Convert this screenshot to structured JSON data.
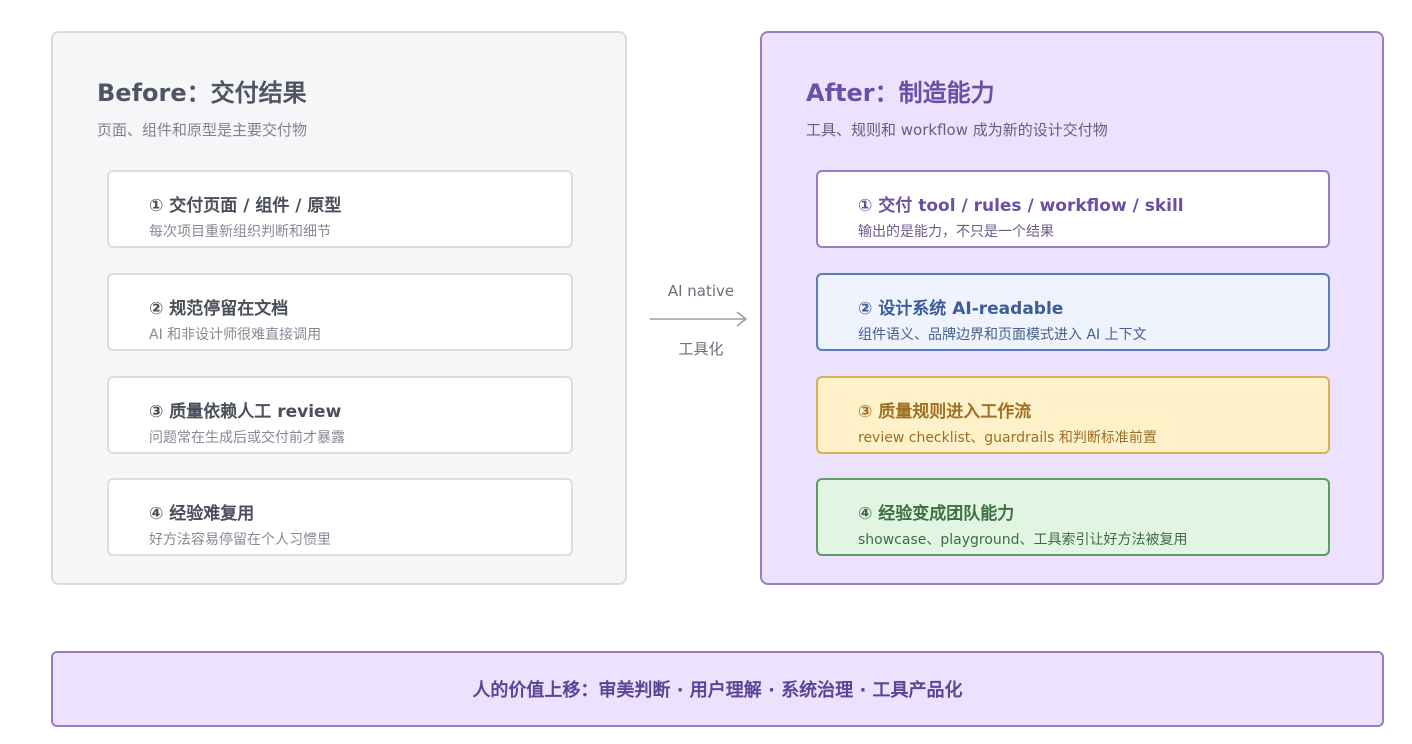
{
  "before": {
    "title": "Before：交付结果",
    "subtitle": "页面、组件和原型是主要交付物",
    "cards": [
      {
        "title": "① 交付页面 / 组件 / 原型",
        "desc": "每次项目重新组织判断和细节"
      },
      {
        "title": "② 规范停留在文档",
        "desc": "AI 和非设计师很难直接调用"
      },
      {
        "title": "③ 质量依赖人工 review",
        "desc": "问题常在生成后或交付前才暴露"
      },
      {
        "title": "④ 经验难复用",
        "desc": "好方法容易停留在个人习惯里"
      }
    ]
  },
  "arrow": {
    "top_label": "AI native",
    "bottom_label": "工具化"
  },
  "after": {
    "title": "After：制造能力",
    "subtitle": "工具、规则和 workflow 成为新的设计交付物",
    "cards": [
      {
        "title": "① 交付 tool / rules / workflow / skill",
        "desc": "输出的是能力，不只是一个结果"
      },
      {
        "title": "② 设计系统 AI-readable",
        "desc": "组件语义、品牌边界和页面模式进入 AI 上下文"
      },
      {
        "title": "③ 质量规则进入工作流",
        "desc": "review checklist、guardrails 和判断标准前置"
      },
      {
        "title": "④ 经验变成团队能力",
        "desc": "showcase、playground、工具索引让好方法被复用"
      }
    ]
  },
  "footer": {
    "text": "人的价值上移：审美判断 · 用户理解 · 系统治理 · 工具产品化"
  },
  "colors": {
    "before_bg": "#f6f6f8",
    "after_bg": "#ece2fd",
    "after_border": "#9a7bc7",
    "blue_card": "#eef3fd",
    "yellow_card": "#fff1c9",
    "green_card": "#e1f5e2"
  }
}
